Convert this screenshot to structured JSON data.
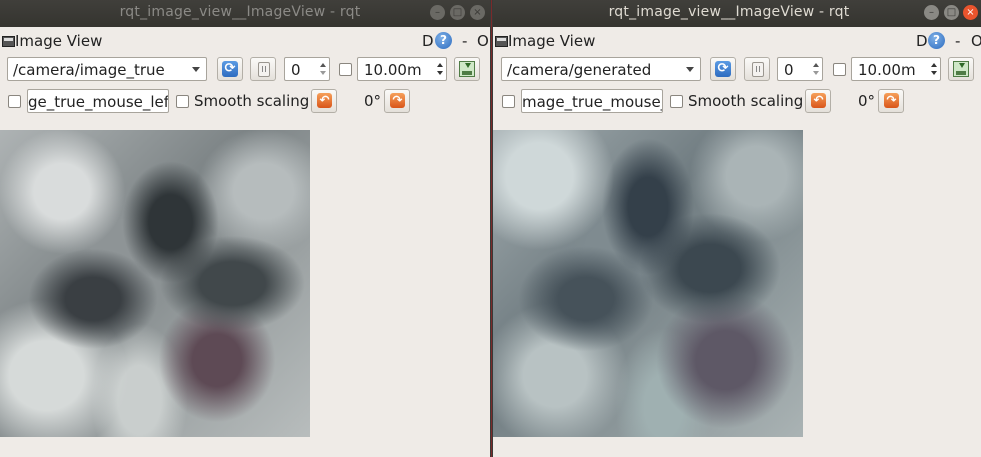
{
  "windows": [
    {
      "title": "rqt_image_view__ImageView - rqt",
      "panel_title": "Image View",
      "help_label": "D",
      "help_glyph": "?",
      "dash_label": "-",
      "o_label": "O",
      "topic": "/camera/image_true",
      "frame_skip": "0",
      "max_range": "10.00m",
      "mouse_topic": "ge_true_mouse_left",
      "smooth_scaling_label": "Smooth scaling",
      "rotation": "0°",
      "active": false
    },
    {
      "title": "rqt_image_view__ImageView - rqt",
      "panel_title": "Image View",
      "help_label": "D",
      "help_glyph": "?",
      "dash_label": "-",
      "o_label": "O",
      "topic": "/camera/generated",
      "frame_skip": "0",
      "max_range": "10.00m",
      "mouse_topic": "mage_true_mouse_le",
      "smooth_scaling_label": "Smooth scaling",
      "rotation": "0°",
      "active": true
    }
  ],
  "icons": {
    "minimize": "–",
    "maximize": "□",
    "close": "×",
    "refresh": "⟳",
    "rotate_left": "↶",
    "rotate_right": "↷"
  },
  "colors": {
    "titlebar": "#3c3b37",
    "close_active": "#e9542d",
    "help_blue": "#2d6cc0",
    "rotate_orange": "#d9561a"
  }
}
